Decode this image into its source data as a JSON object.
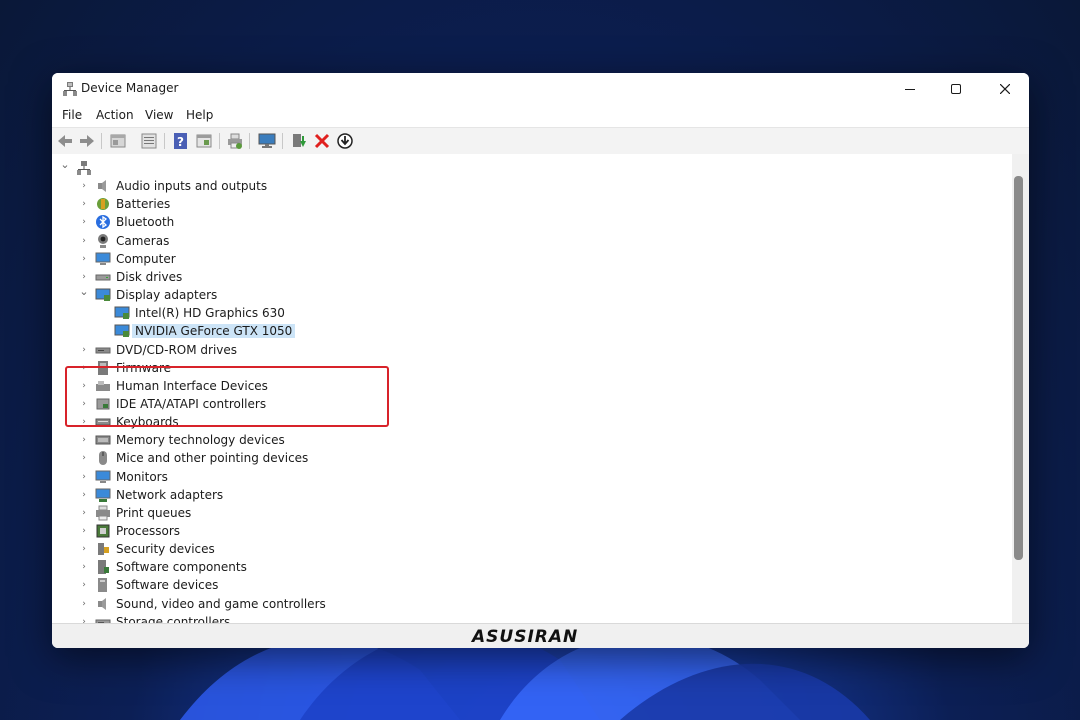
{
  "window": {
    "title": "Device Manager"
  },
  "menu": [
    "File",
    "Action",
    "View",
    "Help"
  ],
  "toolbar_icons": [
    "back-icon",
    "forward-icon",
    "properties-icon",
    "view-icon",
    "help-icon",
    "resource-icon",
    "print-icon",
    "monitor-icon",
    "update-driver-icon",
    "uninstall-icon",
    "download-icon"
  ],
  "tree": {
    "root_icon": "computer-root-icon",
    "categories": [
      {
        "label": "Audio inputs and outputs",
        "icon": "speaker-icon"
      },
      {
        "label": "Batteries",
        "icon": "battery-icon"
      },
      {
        "label": "Bluetooth",
        "icon": "bluetooth-icon"
      },
      {
        "label": "Cameras",
        "icon": "camera-icon"
      },
      {
        "label": "Computer",
        "icon": "computer-icon"
      },
      {
        "label": "Disk drives",
        "icon": "disk-icon"
      },
      {
        "label": "Display adapters",
        "icon": "display-adapter-icon",
        "expanded": true,
        "children": [
          "Intel(R) HD Graphics 630",
          "NVIDIA GeForce GTX 1050"
        ]
      },
      {
        "label": "DVD/CD-ROM drives",
        "icon": "dvd-icon"
      },
      {
        "label": "Firmware",
        "icon": "firmware-icon"
      },
      {
        "label": "Human Interface Devices",
        "icon": "hid-icon"
      },
      {
        "label": "IDE ATA/ATAPI controllers",
        "icon": "ide-icon"
      },
      {
        "label": "Keyboards",
        "icon": "keyboard-icon"
      },
      {
        "label": "Memory technology devices",
        "icon": "memory-icon"
      },
      {
        "label": "Mice and other pointing devices",
        "icon": "mouse-icon"
      },
      {
        "label": "Monitors",
        "icon": "monitor-icon"
      },
      {
        "label": "Network adapters",
        "icon": "network-icon"
      },
      {
        "label": "Print queues",
        "icon": "printer-icon"
      },
      {
        "label": "Processors",
        "icon": "processor-icon"
      },
      {
        "label": "Security devices",
        "icon": "security-icon"
      },
      {
        "label": "Software components",
        "icon": "software-component-icon"
      },
      {
        "label": "Software devices",
        "icon": "software-device-icon"
      },
      {
        "label": "Sound, video and game controllers",
        "icon": "sound-icon"
      },
      {
        "label": "Storage controllers",
        "icon": "storage-icon"
      }
    ]
  },
  "selected_item": "NVIDIA GeForce GTX 1050",
  "watermark": "ASUSIRAN",
  "colors": {
    "selection": "#cce4f7",
    "highlight_box": "#d8232a",
    "desktop": "#0c1f55"
  }
}
